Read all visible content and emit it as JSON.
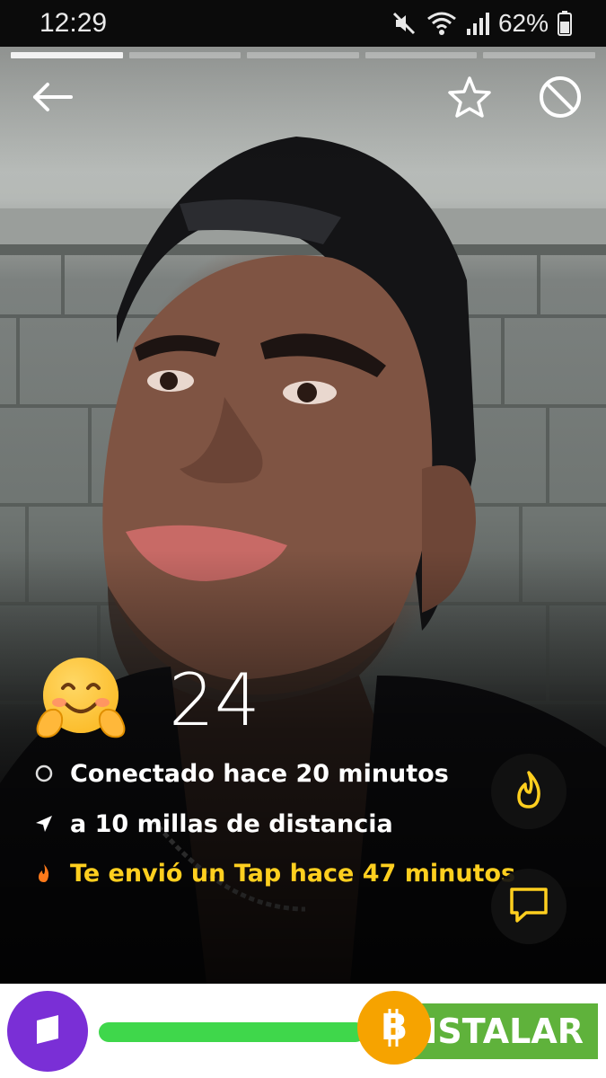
{
  "status_bar": {
    "time": "12:29",
    "battery_percent": "62%",
    "icons": [
      "mute-icon",
      "wifi-icon",
      "signal-icon",
      "battery-icon"
    ]
  },
  "gallery": {
    "photo_count": 5,
    "current_index": 0
  },
  "header": {
    "back_icon": "arrow-left-icon",
    "favorite_icon": "star-icon",
    "block_icon": "block-icon"
  },
  "profile": {
    "emoji": "hugging-face-emoji",
    "age": "24",
    "online_status": "Conectado hace 20 minutos",
    "distance": "a 10 millas de distancia",
    "tap_status": "Te envió un Tap hace 47 minutos"
  },
  "actions": {
    "tap_icon": "flame-icon",
    "chat_icon": "chat-bubble-icon"
  },
  "ad": {
    "button_label": "NSTALAR",
    "progress": 0.55,
    "colors": {
      "bar": "#3fd74b",
      "button": "#5fb23b",
      "logo": "#7a2fd6",
      "coin": "#f6a300"
    }
  },
  "colors": {
    "tap_accent": "#ffcf1f",
    "text": "#ffffff"
  }
}
